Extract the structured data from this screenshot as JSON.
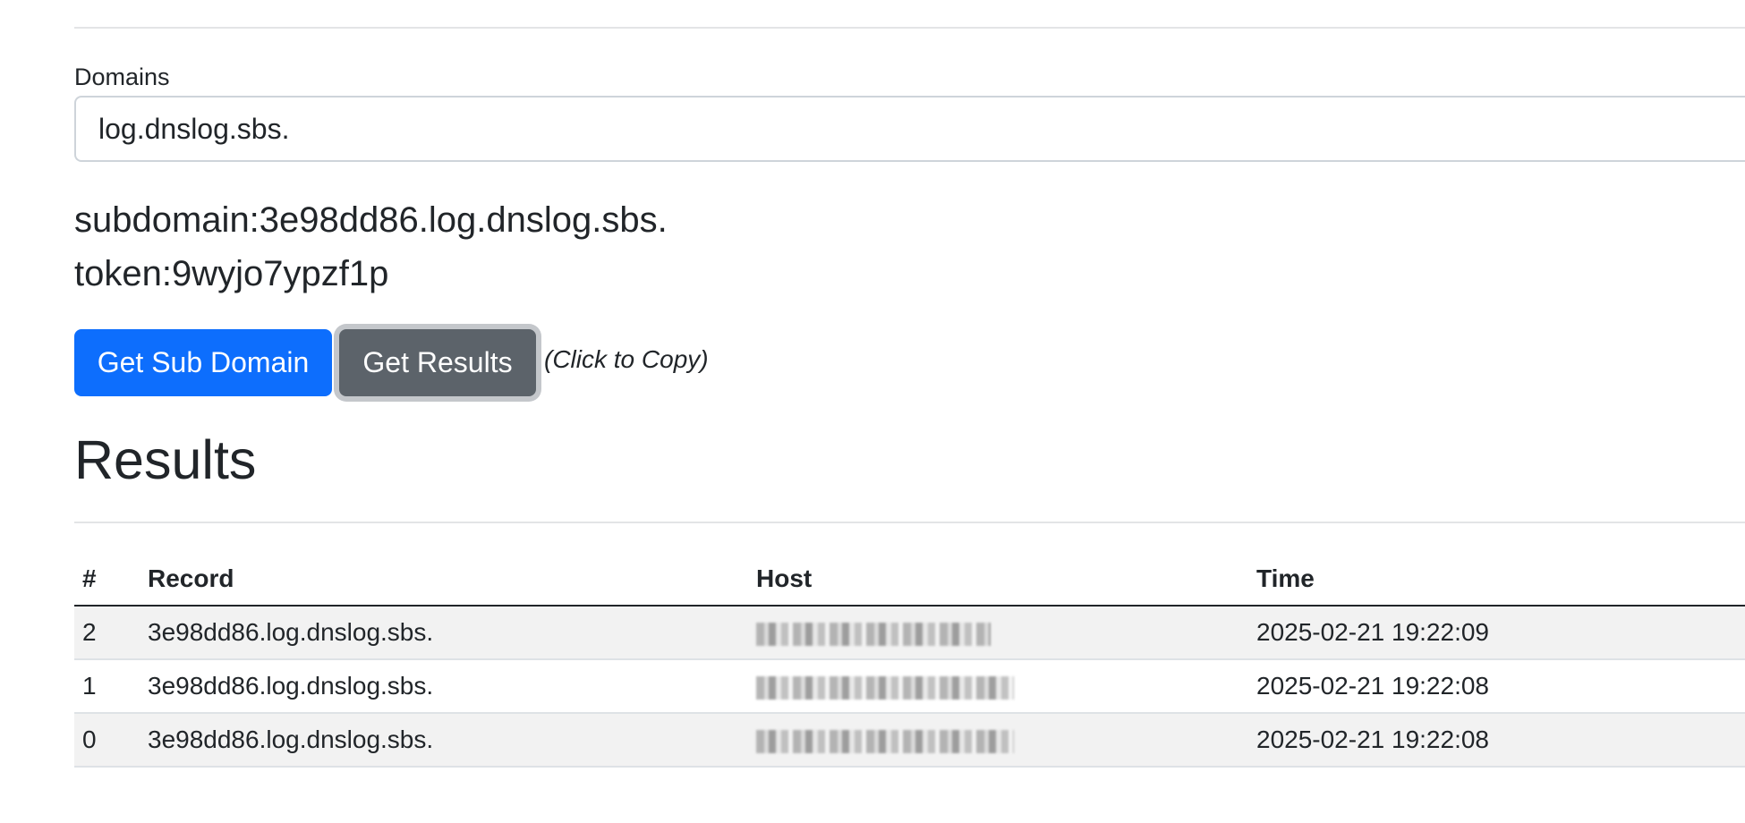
{
  "form": {
    "domains_label": "Domains",
    "domains_value": "log.dnslog.sbs."
  },
  "info": {
    "subdomain_text": "subdomain:3e98dd86.log.dnslog.sbs.",
    "token_text": "token:9wyjo7ypzf1p"
  },
  "actions": {
    "get_sub_domain_label": "Get Sub Domain",
    "get_results_label": "Get Results",
    "copy_hint": "(Click to Copy)"
  },
  "results": {
    "title": "Results",
    "headers": {
      "num": "#",
      "record": "Record",
      "host": "Host",
      "time": "Time"
    },
    "rows": [
      {
        "num": "2",
        "record": "3e98dd86.log.dnslog.sbs.",
        "host": "",
        "time": "2025-02-21 19:22:09"
      },
      {
        "num": "1",
        "record": "3e98dd86.log.dnslog.sbs.",
        "host": "",
        "time": "2025-02-21 19:22:08"
      },
      {
        "num": "0",
        "record": "3e98dd86.log.dnslog.sbs.",
        "host": "",
        "time": "2025-02-21 19:22:08"
      }
    ]
  },
  "colors": {
    "primary": "#0d6efd",
    "secondary": "#5c636a",
    "text": "#212529",
    "stripe": "#f2f2f2"
  }
}
